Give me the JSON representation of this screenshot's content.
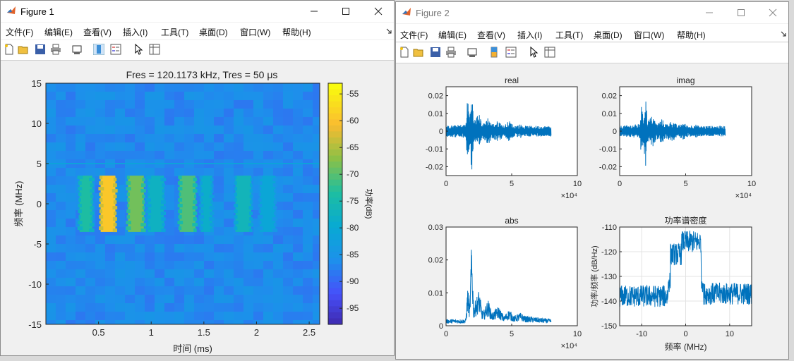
{
  "colors": {
    "accent": "#0072bd",
    "colormap_low": "#3e26a8",
    "colormap_high": "#f9fb0e"
  },
  "figure1": {
    "title": "Figure 1",
    "menu": [
      "文件(F)",
      "编辑(E)",
      "查看(V)",
      "插入(I)",
      "工具(T)",
      "桌面(D)",
      "窗口(W)",
      "帮助(H)"
    ],
    "chart_data": {
      "type": "heatmap",
      "title": "Fres = 120.1173 kHz, Tres = 50 μs",
      "xlabel": "时间 (ms)",
      "ylabel": "频率 (MHz)",
      "xticks": [
        "0.5",
        "1",
        "1.5",
        "2",
        "2.5"
      ],
      "yticks": [
        "15",
        "10",
        "5",
        "0",
        "-5",
        "-10",
        "-15"
      ],
      "xlim": [
        0,
        2.6
      ],
      "ylim": [
        -15,
        15
      ],
      "colorbar_label": "功率(dB)",
      "colorbar_ticks": [
        "-55",
        "-60",
        "-65",
        "-70",
        "-75",
        "-80",
        "-85",
        "-90",
        "-95"
      ],
      "clim": [
        -98,
        -53
      ],
      "background_level_db": -86,
      "bursts": [
        {
          "t_start": 0.32,
          "t_end": 0.44,
          "f_low": -3.5,
          "f_high": 3.5,
          "power_db": -73
        },
        {
          "t_start": 0.52,
          "t_end": 0.66,
          "f_low": -3.5,
          "f_high": 3.5,
          "power_db": -59
        },
        {
          "t_start": 0.78,
          "t_end": 0.93,
          "f_low": -3.5,
          "f_high": 3.5,
          "power_db": -68
        },
        {
          "t_start": 0.97,
          "t_end": 1.12,
          "f_low": -3.5,
          "f_high": 3.5,
          "power_db": -77
        },
        {
          "t_start": 1.27,
          "t_end": 1.42,
          "f_low": -3.5,
          "f_high": 3.5,
          "power_db": -70
        },
        {
          "t_start": 1.47,
          "t_end": 1.58,
          "f_low": -3.5,
          "f_high": 3.5,
          "power_db": -78
        },
        {
          "t_start": 1.8,
          "t_end": 1.95,
          "f_low": -3.5,
          "f_high": 3.5,
          "power_db": -76
        },
        {
          "t_start": 2.03,
          "t_end": 2.18,
          "f_low": -3.5,
          "f_high": 3.5,
          "power_db": -80
        }
      ]
    }
  },
  "figure2": {
    "title": "Figure 2",
    "menu": [
      "文件(F)",
      "编辑(E)",
      "查看(V)",
      "插入(I)",
      "工具(T)",
      "桌面(D)",
      "窗口(W)",
      "帮助(H)"
    ],
    "chart_data": [
      {
        "type": "line",
        "title": "real",
        "xticks": [
          "0",
          "5",
          "10"
        ],
        "yticks": [
          "0.02",
          "0.01",
          "0",
          "-0.01",
          "-0.02"
        ],
        "xlim": [
          0,
          10
        ],
        "ylim": [
          -0.025,
          0.025
        ],
        "x_exponent": "×10⁴",
        "signal_end": 8,
        "envelope": [
          [
            0,
            0.003
          ],
          [
            1.5,
            0.004
          ],
          [
            1.65,
            0.02
          ],
          [
            1.8,
            0.008
          ],
          [
            1.95,
            0.025
          ],
          [
            2.1,
            0.006
          ],
          [
            2.5,
            0.01
          ],
          [
            2.8,
            0.004
          ],
          [
            3.2,
            0.008
          ],
          [
            3.5,
            0.004
          ],
          [
            4.0,
            0.006
          ],
          [
            4.4,
            0.003
          ],
          [
            4.8,
            0.006
          ],
          [
            5.2,
            0.003
          ],
          [
            5.7,
            0.004
          ],
          [
            6.0,
            0.003
          ],
          [
            8,
            0.003
          ]
        ]
      },
      {
        "type": "line",
        "title": "imag",
        "xticks": [
          "0",
          "5",
          "10"
        ],
        "yticks": [
          "0.02",
          "0.01",
          "0",
          "-0.01",
          "-0.02"
        ],
        "xlim": [
          0,
          10
        ],
        "ylim": [
          -0.025,
          0.025
        ],
        "x_exponent": "×10⁴",
        "signal_end": 8,
        "envelope": [
          [
            0,
            0.003
          ],
          [
            1.5,
            0.004
          ],
          [
            1.65,
            0.015
          ],
          [
            1.8,
            0.006
          ],
          [
            1.95,
            0.024
          ],
          [
            2.1,
            0.006
          ],
          [
            2.5,
            0.009
          ],
          [
            2.8,
            0.004
          ],
          [
            3.2,
            0.007
          ],
          [
            3.5,
            0.004
          ],
          [
            4.0,
            0.006
          ],
          [
            4.4,
            0.003
          ],
          [
            4.8,
            0.005
          ],
          [
            5.2,
            0.003
          ],
          [
            5.7,
            0.004
          ],
          [
            6.0,
            0.003
          ],
          [
            8,
            0.003
          ]
        ]
      },
      {
        "type": "line",
        "title": "abs",
        "xticks": [
          "0",
          "5",
          "10"
        ],
        "yticks": [
          "0.03",
          "0.02",
          "0.01",
          "0"
        ],
        "xlim": [
          0,
          10
        ],
        "ylim": [
          0,
          0.03
        ],
        "x_exponent": "×10⁴",
        "signal_end": 8,
        "envelope": [
          [
            0,
            0.002
          ],
          [
            1.5,
            0.002
          ],
          [
            1.65,
            0.012
          ],
          [
            1.8,
            0.006
          ],
          [
            1.95,
            0.027
          ],
          [
            2.1,
            0.006
          ],
          [
            2.5,
            0.011
          ],
          [
            2.8,
            0.004
          ],
          [
            3.2,
            0.008
          ],
          [
            3.5,
            0.004
          ],
          [
            4.0,
            0.006
          ],
          [
            4.4,
            0.003
          ],
          [
            4.8,
            0.005
          ],
          [
            5.2,
            0.003
          ],
          [
            5.7,
            0.004
          ],
          [
            6.0,
            0.003
          ],
          [
            8,
            0.002
          ]
        ]
      },
      {
        "type": "line",
        "title": "功率谱密度",
        "xlabel": "频率 (MHz)",
        "ylabel": "功率/频率 (dB/Hz)",
        "xticks": [
          "-10",
          "0",
          "10"
        ],
        "yticks": [
          "-110",
          "-120",
          "-130",
          "-140",
          "-150"
        ],
        "xlim": [
          -15,
          15
        ],
        "ylim": [
          -150,
          -110
        ],
        "grid": true,
        "segments": [
          {
            "f_from": -15,
            "f_to": -4,
            "level": -138
          },
          {
            "f_from": -4,
            "f_to": -3.5,
            "level": -132
          },
          {
            "f_from": -3.5,
            "f_to": -1,
            "level": -121
          },
          {
            "f_from": -1,
            "f_to": 3.5,
            "level": -116
          },
          {
            "f_from": 3.5,
            "f_to": 4,
            "level": -132
          },
          {
            "f_from": 4,
            "f_to": 15,
            "level": -137
          }
        ]
      }
    ]
  }
}
